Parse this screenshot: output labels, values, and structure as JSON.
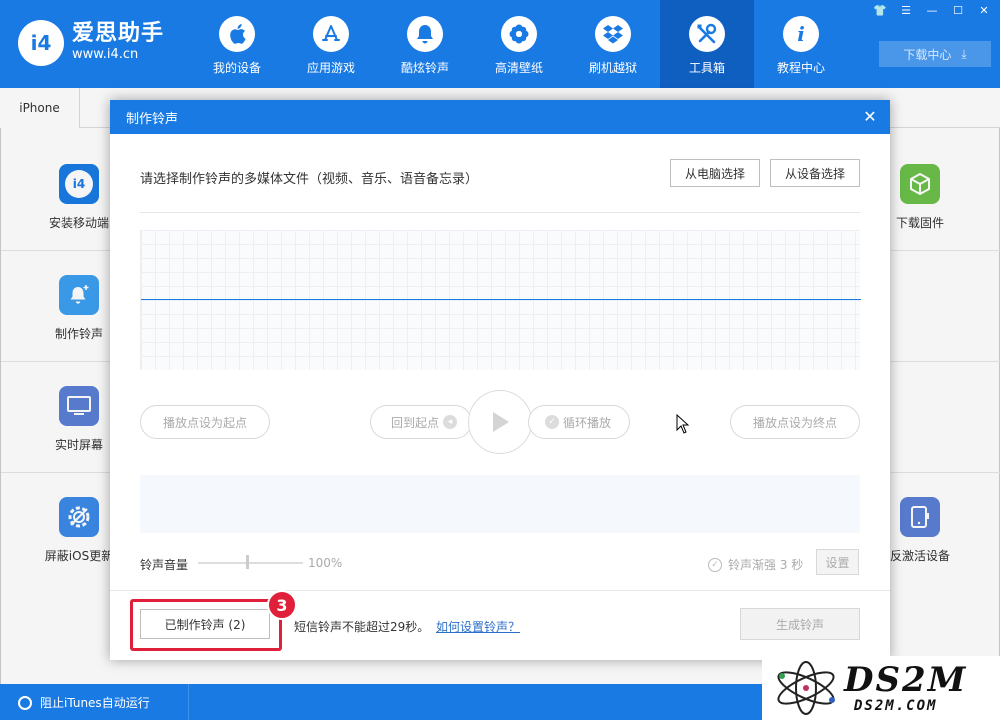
{
  "app": {
    "logo_mark": "i4",
    "name": "爱思助手",
    "url": "www.i4.cn"
  },
  "nav": [
    {
      "label": "我的设备",
      "icon": "apple-icon"
    },
    {
      "label": "应用游戏",
      "icon": "app-store-icon"
    },
    {
      "label": "酷炫铃声",
      "icon": "bell-icon"
    },
    {
      "label": "高清壁纸",
      "icon": "flower-icon"
    },
    {
      "label": "刷机越狱",
      "icon": "dropbox-icon"
    },
    {
      "label": "工具箱",
      "icon": "tools-icon",
      "active": true
    },
    {
      "label": "教程中心",
      "icon": "info-icon"
    }
  ],
  "window_controls": [
    "shirt-icon",
    "menu-icon",
    "minimize-icon",
    "maximize-icon",
    "close-icon"
  ],
  "download_center": "下载中心",
  "device_tab": "iPhone",
  "tools_left": [
    {
      "label": "安装移动端",
      "icon": "i4-app-icon",
      "color": "#1a7ae3"
    },
    {
      "label": "制作铃声",
      "icon": "bell-plus-icon",
      "color": "#3da0f0"
    },
    {
      "label": "实时屏幕",
      "icon": "monitor-icon",
      "color": "#5b7fd6"
    },
    {
      "label": "屏蔽iOS更新",
      "icon": "gear-block-icon",
      "color": "#3b8ae8"
    }
  ],
  "tools_right": [
    {
      "label": "下载固件",
      "icon": "box-icon",
      "color": "#6cc04a"
    },
    {
      "label": "反激活设备",
      "icon": "device-icon",
      "color": "#5b7fd6"
    }
  ],
  "statusbar": {
    "itunes_label": "阻止iTunes自动运行"
  },
  "modal": {
    "title": "制作铃声",
    "prompt": "请选择制作铃声的多媒体文件（视频、音乐、语音备忘录）",
    "from_pc": "从电脑选择",
    "from_device": "从设备选择",
    "set_start": "播放点设为起点",
    "back_to_start": "回到起点",
    "loop_play": "循环播放",
    "set_end": "播放点设为终点",
    "volume_label": "铃声音量",
    "volume_value": "100%",
    "volume_level": 0.5,
    "fade_label": "铃声渐强 3 秒",
    "settings_btn": "设置",
    "made_btn": "已制作铃声 (2)",
    "step_badge": "3",
    "note": "短信铃声不能超过29秒。",
    "help_link": "如何设置铃声？",
    "generate_btn": "生成铃声"
  },
  "watermark": {
    "text": "DS2M",
    "sub": "DS2M.COM"
  },
  "colors": {
    "primary": "#1a7ae3",
    "active_nav": "#0f5fc0",
    "highlight": "#e0203a",
    "link": "#2a6fc8"
  }
}
